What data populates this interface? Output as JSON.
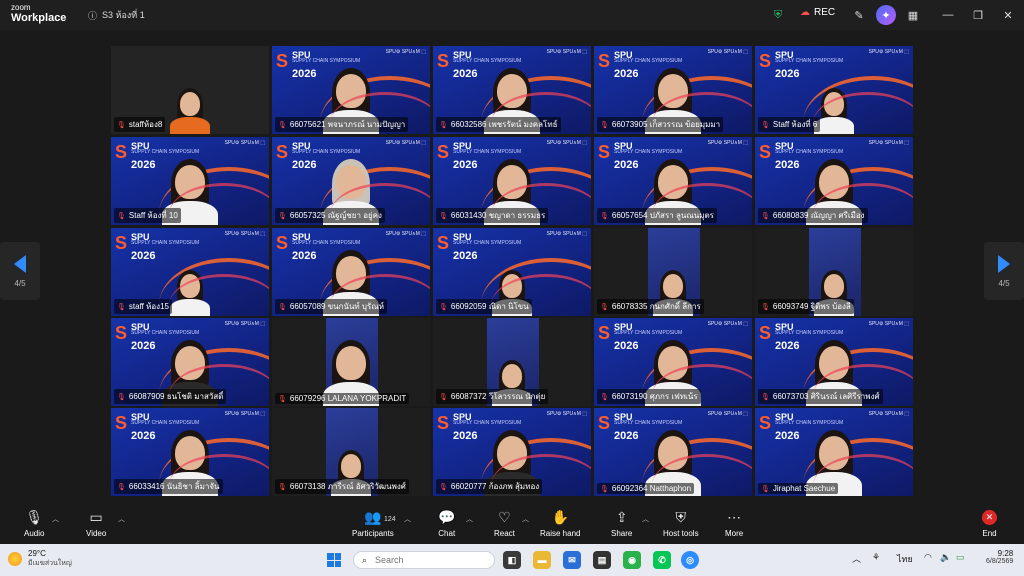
{
  "app": {
    "brand_top": "zoom",
    "brand_bottom": "Workplace",
    "meeting_title": "S3 ห้องที่ 1"
  },
  "topbar": {
    "rec_label": "REC"
  },
  "pager": {
    "left_label": "4/5",
    "right_label": "4/5"
  },
  "banner": {
    "spu": "SPU",
    "chain": "SUPPLY CHAIN SYMPOSIUM",
    "year": "2026",
    "sponsors": "SPU⚙ SPU∧M ⬚"
  },
  "tiles": [
    {
      "name": "staffห้อง8",
      "kind": "room",
      "person": "orange"
    },
    {
      "name": "66075621 พจนาภรณ์ นามปัญญา",
      "kind": "banner",
      "person": "normal"
    },
    {
      "name": "66032586 เพชรรัตน์ มงคลโทธ์",
      "kind": "banner",
      "person": "normal"
    },
    {
      "name": "66073905 เก็สวรรณ ข้อยมุมมา",
      "kind": "banner",
      "person": "normal"
    },
    {
      "name": "Staff ห้องที่ 6",
      "kind": "banner",
      "person": "small"
    },
    {
      "name": "Staff ห้องที่ 10",
      "kind": "banner",
      "person": "normal"
    },
    {
      "name": "66057325 ณัฐญ์ชยา อยู่คง",
      "kind": "banner",
      "person": "light"
    },
    {
      "name": "66031430 ชญาดา ธรรมธร",
      "kind": "banner",
      "person": "normal"
    },
    {
      "name": "66057654 ปภัสรา ลูนณนมุตร",
      "kind": "banner",
      "person": "normal"
    },
    {
      "name": "66080839 ณัญญา ศรีเมือง",
      "kind": "banner",
      "person": "normal"
    },
    {
      "name": "staff ห้อง15",
      "kind": "banner",
      "person": "small"
    },
    {
      "name": "66057089 ขนกนันท์ บุรัณห์",
      "kind": "banner",
      "person": "normal"
    },
    {
      "name": "66092059 ณิดา นิโขน",
      "kind": "banner",
      "person": "small"
    },
    {
      "name": "66078335 กนกศักดิ์ ลีการ",
      "kind": "dark",
      "person": "small"
    },
    {
      "name": "66093749 ฐิติพร บ้องลี",
      "kind": "dark",
      "person": "small"
    },
    {
      "name": "66087909 ธนโชติ มาสวัสดิ์",
      "kind": "banner",
      "person": "dkbody"
    },
    {
      "name": "66079296 LALANA YOKPRADIT",
      "kind": "dark",
      "person": "normal"
    },
    {
      "name": "66087372 วีโลวรรณ นักตุ่ย",
      "kind": "dark",
      "person": "small"
    },
    {
      "name": "66073190 ศุภกร เฟทเน้ร",
      "kind": "banner",
      "person": "normal"
    },
    {
      "name": "66073703 ศิรินรณ์ เลศิรีราพงศ์",
      "kind": "banner",
      "person": "normal"
    },
    {
      "name": "66033416 นันธิชา ลิ้มาจัน",
      "kind": "banner",
      "person": "normal"
    },
    {
      "name": "66073138 ภารีรณ์ อัศวริวัฒนพงศ์",
      "kind": "dark",
      "person": "small"
    },
    {
      "name": "66020777 ก้องภพ สุ้มทอง",
      "kind": "banner",
      "person": "dkbody"
    },
    {
      "name": "66092364 Natthaphon",
      "kind": "banner",
      "person": "normal"
    },
    {
      "name": "Jiraphat Saechue",
      "kind": "banner",
      "person": "normal"
    }
  ],
  "toolbar": {
    "audio": "Audio",
    "video": "Video",
    "participants": "Participants",
    "participant_count": "124",
    "chat": "Chat",
    "react": "React",
    "raise_hand": "Raise hand",
    "share": "Share",
    "host_tools": "Host tools",
    "more": "More",
    "end": "End"
  },
  "taskbar": {
    "temperature": "29°C",
    "weather_desc": "มีเมฆส่วนใหญ่",
    "search_placeholder": "Search",
    "lang": "ไทย",
    "time": "9:28",
    "date": "6/8/2569"
  },
  "colors": {
    "accent": "#2f8cff",
    "end_red": "#e02828",
    "banner_blue": "#13268c",
    "brand_orange": "#ff5b2b"
  }
}
